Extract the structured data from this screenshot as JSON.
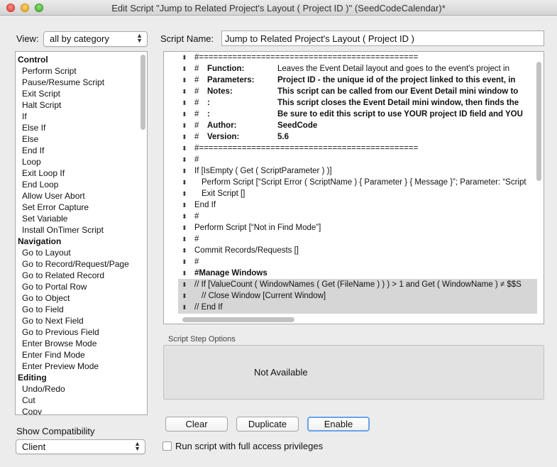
{
  "window": {
    "title": "Edit Script \"Jump to Related Project's Layout ( Project ID )\" (SeedCodeCalendar)*"
  },
  "left": {
    "view_label": "View:",
    "view_value": "all by category",
    "steps": [
      {
        "text": "Control",
        "cat": true
      },
      {
        "text": "Perform Script"
      },
      {
        "text": "Pause/Resume Script"
      },
      {
        "text": "Exit Script"
      },
      {
        "text": "Halt Script"
      },
      {
        "text": "If"
      },
      {
        "text": "Else If"
      },
      {
        "text": "Else"
      },
      {
        "text": "End If"
      },
      {
        "text": "Loop"
      },
      {
        "text": "Exit Loop If"
      },
      {
        "text": "End Loop"
      },
      {
        "text": "Allow User Abort"
      },
      {
        "text": "Set Error Capture"
      },
      {
        "text": "Set Variable"
      },
      {
        "text": "Install OnTimer Script"
      },
      {
        "text": "Navigation",
        "cat": true
      },
      {
        "text": "Go to Layout"
      },
      {
        "text": "Go to Record/Request/Page"
      },
      {
        "text": "Go to Related Record"
      },
      {
        "text": "Go to Portal Row"
      },
      {
        "text": "Go to Object"
      },
      {
        "text": "Go to Field"
      },
      {
        "text": "Go to Next Field"
      },
      {
        "text": "Go to Previous Field"
      },
      {
        "text": "Enter Browse Mode"
      },
      {
        "text": "Enter Find Mode"
      },
      {
        "text": "Enter Preview Mode"
      },
      {
        "text": "Editing",
        "cat": true
      },
      {
        "text": "Undo/Redo"
      },
      {
        "text": "Cut"
      },
      {
        "text": "Copy"
      }
    ],
    "compat_label": "Show Compatibility",
    "compat_value": "Client"
  },
  "script": {
    "name_label": "Script Name:",
    "name_value": "Jump to Related Project's Layout ( Project ID )",
    "lines": [
      {
        "indent": 0,
        "a": "#==============================================",
        "b": "",
        "c": ""
      },
      {
        "indent": 0,
        "a": "#",
        "b": "Function:",
        "c": "Leaves the Event Detail layout and goes to the event's project in",
        "bold": true,
        "cbold": false
      },
      {
        "indent": 0,
        "a": "#",
        "b": "Parameters:",
        "c": "Project ID - the unique id of the project linked to this event, in",
        "bold": true,
        "cbold": true
      },
      {
        "indent": 0,
        "a": "#",
        "b": "Notes:",
        "c": "This script can be called from our Event Detail mini window to",
        "bold": true,
        "cbold": true
      },
      {
        "indent": 0,
        "a": "#",
        "b": ":",
        "c": "This script closes the Event Detail mini window, then finds the",
        "bold": true,
        "cbold": true
      },
      {
        "indent": 0,
        "a": "#",
        "b": ":",
        "c": "Be sure to edit this script to use YOUR project ID field and YOU",
        "bold": true,
        "cbold": true
      },
      {
        "indent": 0,
        "a": "#",
        "b": "Author:",
        "c": "SeedCode",
        "bold": true,
        "cbold": true
      },
      {
        "indent": 0,
        "a": "#",
        "b": "Version:",
        "c": "5.6",
        "bold": true,
        "cbold": true
      },
      {
        "indent": 0,
        "a": "#==============================================",
        "b": "",
        "c": ""
      },
      {
        "indent": 0,
        "a": "#",
        "b": "",
        "c": ""
      },
      {
        "indent": 0,
        "a": "If [IsEmpty ( Get ( ScriptParameter ) )]",
        "b": "",
        "c": ""
      },
      {
        "indent": 1,
        "a": "Perform Script [“Script Error ( ScriptName ) { Parameter } { Message }”; Parameter: “Script",
        "b": "",
        "c": ""
      },
      {
        "indent": 1,
        "a": "Exit Script []",
        "b": "",
        "c": ""
      },
      {
        "indent": 0,
        "a": "End If",
        "b": "",
        "c": ""
      },
      {
        "indent": 0,
        "a": "#",
        "b": "",
        "c": ""
      },
      {
        "indent": 0,
        "a": "Perform Script [“Not in Find Mode”]",
        "b": "",
        "c": ""
      },
      {
        "indent": 0,
        "a": "#",
        "b": "",
        "c": ""
      },
      {
        "indent": 0,
        "a": "Commit Records/Requests []",
        "b": "",
        "c": ""
      },
      {
        "indent": 0,
        "a": "#",
        "b": "",
        "c": ""
      },
      {
        "indent": 0,
        "a": "#Manage Windows",
        "b": "",
        "c": "",
        "abold": true
      },
      {
        "indent": 0,
        "a": "//  If [ValueCount ( WindowNames ( Get (FileName ) ) ) > 1 and Get ( WindowName ) ≠ $$S",
        "b": "",
        "c": "",
        "disabled": true
      },
      {
        "indent": 1,
        "a": "//  Close Window [Current Window]",
        "b": "",
        "c": "",
        "disabled": true
      },
      {
        "indent": 0,
        "a": "//  End If",
        "b": "",
        "c": "",
        "disabled": true
      },
      {
        "indent": 0,
        "a": "",
        "b": "",
        "c": "",
        "disabled": true
      }
    ]
  },
  "options": {
    "label": "Script Step Options",
    "value": "Not Available"
  },
  "buttons": {
    "clear": "Clear",
    "duplicate": "Duplicate",
    "enable": "Enable"
  },
  "checkbox": {
    "label": "Run script with full access privileges"
  },
  "icons": {
    "handle": "move-handle-icon",
    "popup_arrows": "up-down-arrows-icon"
  }
}
